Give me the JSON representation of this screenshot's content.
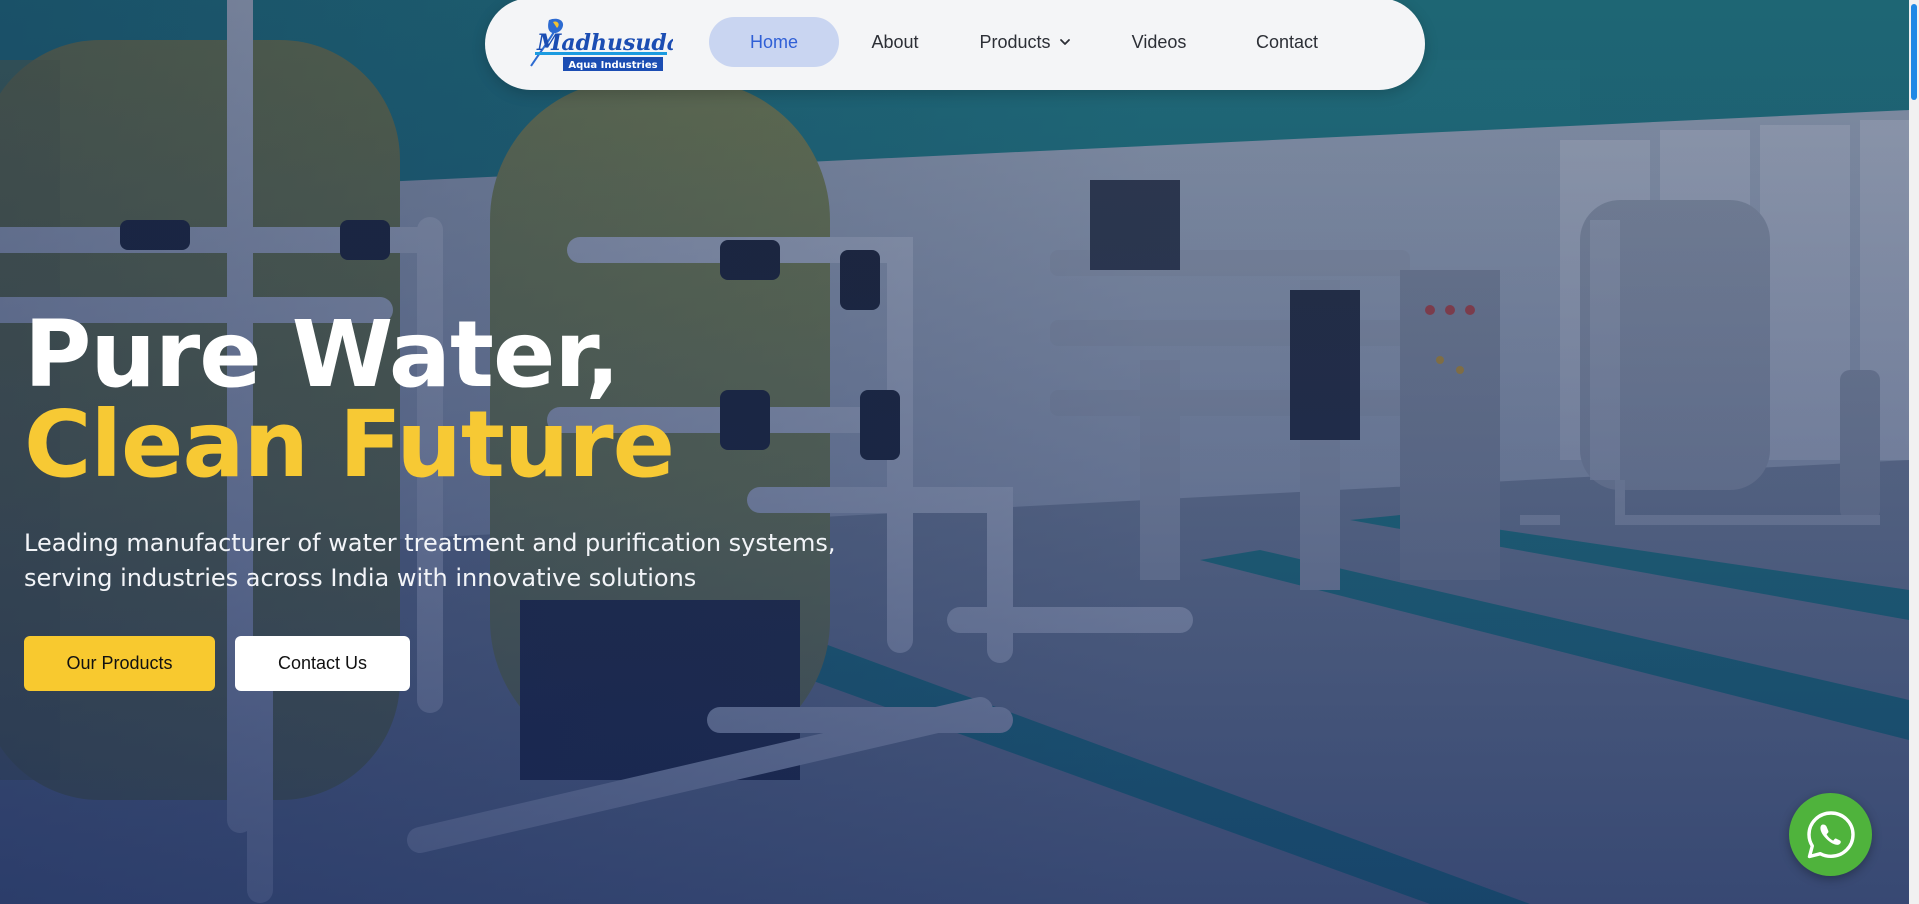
{
  "nav": {
    "logo": {
      "brand": "Madhusudan",
      "sub": "Aqua Industries"
    },
    "items": [
      {
        "label": "Home",
        "active": true
      },
      {
        "label": "About"
      },
      {
        "label": "Products",
        "has_dropdown": true
      },
      {
        "label": "Videos"
      },
      {
        "label": "Contact"
      }
    ]
  },
  "hero": {
    "headline_line1": "Pure Water,",
    "headline_line2": "Clean Future",
    "subtext": "Leading manufacturer of water treatment and purification systems, serving industries across India with innovative solutions",
    "primary_button": "Our Products",
    "secondary_button": "Contact Us"
  },
  "floating": {
    "whatsapp_icon": "whatsapp-icon"
  },
  "colors": {
    "accent_yellow": "#f7c934",
    "nav_active_bg": "#c9d5f1",
    "nav_active_text": "#2f5fd6",
    "whatsapp_green": "#4fb33c"
  }
}
